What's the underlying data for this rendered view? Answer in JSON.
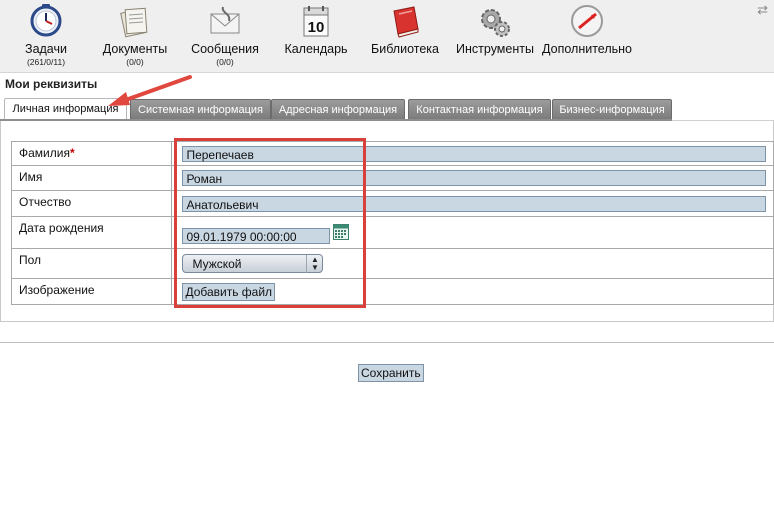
{
  "toolbar": {
    "tools": [
      {
        "label": "Задачи",
        "count": "(261/0/11)"
      },
      {
        "label": "Документы",
        "count": "(0/0)"
      },
      {
        "label": "Сообщения",
        "count": "(0/0)"
      },
      {
        "label": "Календарь",
        "count": ""
      },
      {
        "label": "Библиотека",
        "count": ""
      },
      {
        "label": "Инструменты",
        "count": ""
      },
      {
        "label": "Дополнительно",
        "count": ""
      }
    ],
    "calendar_day": "10",
    "refresh_icon": "⇄"
  },
  "section": {
    "title": "Мои реквизиты"
  },
  "tabs": [
    {
      "label": "Личная информация",
      "active": true
    },
    {
      "label": "Системная информация",
      "active": false
    },
    {
      "label": "Адресная информация",
      "active": false
    },
    {
      "label": "Контактная информация",
      "active": false
    },
    {
      "label": "Бизнес-информация",
      "active": false
    }
  ],
  "form": {
    "last_name": {
      "label": "Фамилия",
      "required_mark": "*",
      "value": "Перепечаев"
    },
    "first_name": {
      "label": "Имя",
      "value": "Роман"
    },
    "middle_name": {
      "label": "Отчество",
      "value": "Анатольевич"
    },
    "birth_date": {
      "label": "Дата рождения",
      "value": "09.01.1979 00:00:00"
    },
    "gender": {
      "label": "Пол",
      "value": "Мужской"
    },
    "image": {
      "label": "Изображение",
      "button": "Добавить файл"
    }
  },
  "save_button": "Сохранить",
  "colors": {
    "highlight": "#d9403b",
    "arrow": "#e0473e",
    "input_bg": "#c9d7e3"
  }
}
